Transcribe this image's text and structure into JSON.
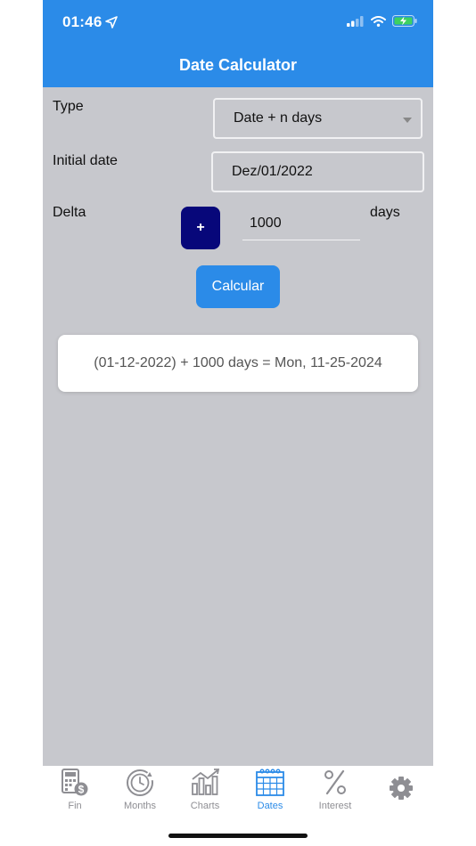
{
  "status": {
    "time": "01:46",
    "icons": [
      "location-arrow-icon",
      "signal-icon",
      "wifi-icon",
      "battery-charging-icon"
    ]
  },
  "header": {
    "title": "Date Calculator"
  },
  "form": {
    "type_label": "Type",
    "type_value": "Date + n days",
    "initial_date_label": "Initial date",
    "initial_date_value": "Dez/01/2022",
    "delta_label": "Delta",
    "delta_sign": "+",
    "delta_value": "1000",
    "delta_unit": "days",
    "calc_button": "Calcular"
  },
  "result": {
    "text": "(01-12-2022) + 1000 days = Mon, 11-25-2024"
  },
  "tabs": [
    {
      "label": "Fin",
      "icon": "calculator-dollar-icon"
    },
    {
      "label": "Months",
      "icon": "clock-cycle-icon"
    },
    {
      "label": "Charts",
      "icon": "bar-chart-icon"
    },
    {
      "label": "Dates",
      "icon": "calendar-icon",
      "active": true
    },
    {
      "label": "Interest",
      "icon": "percent-icon"
    },
    {
      "label": "",
      "icon": "gear-icon"
    }
  ],
  "colors": {
    "accent": "#2b8be8",
    "plus_button": "#07077a",
    "background": "#c7c8cd",
    "tab_inactive": "#8e8e93"
  }
}
